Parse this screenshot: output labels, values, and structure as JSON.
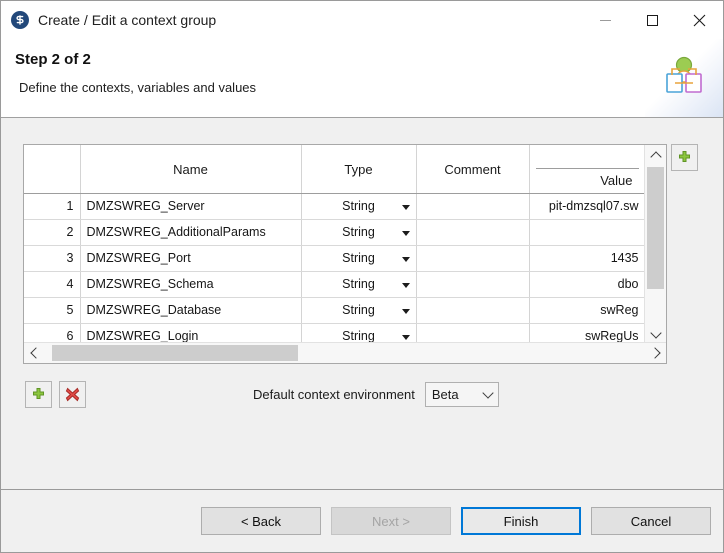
{
  "window": {
    "title": "Create / Edit a context group",
    "app_icon": "talend-icon",
    "minimize_label": "Minimize",
    "maximize_label": "Maximize",
    "close_label": "Close"
  },
  "header": {
    "step_title": "Step 2 of 2",
    "description": "Define the contexts, variables and values",
    "banner_icon": "context-group-icon"
  },
  "table": {
    "columns": [
      "",
      "Name",
      "Type",
      "Comment",
      ""
    ],
    "headers": {
      "num": "",
      "name": "Name",
      "type": "Type",
      "comment": "Comment",
      "value_top": "",
      "value": "Value"
    },
    "rows": [
      {
        "num": "1",
        "name": "DMZSWREG_Server",
        "type": "String",
        "comment": "",
        "value": "pit-dmzsql07.sw"
      },
      {
        "num": "2",
        "name": "DMZSWREG_AdditionalParams",
        "type": "String",
        "comment": "",
        "value": ""
      },
      {
        "num": "3",
        "name": "DMZSWREG_Port",
        "type": "String",
        "comment": "",
        "value": "1435"
      },
      {
        "num": "4",
        "name": "DMZSWREG_Schema",
        "type": "String",
        "comment": "",
        "value": "dbo"
      },
      {
        "num": "5",
        "name": "DMZSWREG_Database",
        "type": "String",
        "comment": "",
        "value": "swReg"
      },
      {
        "num": "6",
        "name": "DMZSWREG_Login",
        "type": "String",
        "comment": "",
        "value": "swRegUs"
      }
    ]
  },
  "toolbar": {
    "add_column_label": "add-column",
    "add_row_label": "add-row",
    "delete_row_label": "delete-row"
  },
  "environment": {
    "label": "Default context environment",
    "selected": "Beta"
  },
  "footer": {
    "back": "< Back",
    "next": "Next >",
    "finish": "Finish",
    "cancel": "Cancel"
  },
  "colors": {
    "accent": "#0078d7",
    "title_icon_bg": "#22487a",
    "add_green": "#6cb33f",
    "delete_red": "#d9413c",
    "chrome": "#f0f0f0"
  }
}
